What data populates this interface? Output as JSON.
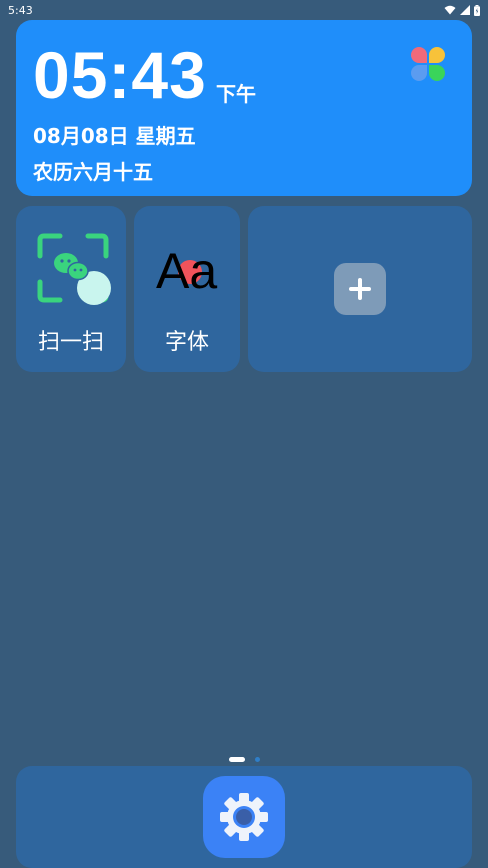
{
  "status_bar": {
    "time": "5:43",
    "icons": [
      "wifi-icon",
      "signal-icon",
      "battery-icon"
    ]
  },
  "clock_widget": {
    "time": "05:43",
    "ampm": "下午",
    "date": "08月08日  星期五",
    "lunar": "农历六月十五",
    "background_color": "#1f8efa",
    "icon": "flower-app-icon"
  },
  "shortcuts": [
    {
      "label": "扫一扫",
      "icon": "scan-wechat-icon"
    },
    {
      "label": "字体",
      "icon": "font-aa-icon"
    },
    {
      "label": "",
      "icon": "plus-icon"
    }
  ],
  "font_icon_text": "Aa",
  "page_indicator": {
    "pages": 2,
    "current": 1
  },
  "dock": {
    "apps": [
      {
        "icon": "settings-gear-icon"
      }
    ]
  },
  "colors": {
    "wallpaper": "#375b7b",
    "tile": "#2f669e",
    "scan_green": "#3ad47e",
    "settings_blue": "#3b82f6"
  }
}
